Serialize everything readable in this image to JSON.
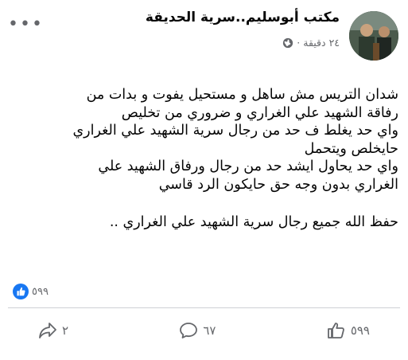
{
  "post": {
    "page_name": "مكتب أبوسليم..سرية الحديقة",
    "time": "٢٤ دقيقة",
    "visibility_icon": "globe-icon",
    "lines": [
      "شدان التريس مش ساهل و مستحيل يفوت و بدات من",
      "رفاقة الشهيد علي الغراري و ضروري من تخليص",
      "واي حد يغلط ف حد من رجال سرية الشهيد علي الغراري",
      "حايخلص ويتحمل",
      "واي حد يحاول ايشد حد من رجال ورفاق الشهيد علي",
      "الغراري بدون وجه حق حايكون الرد قاسي"
    ],
    "closing": "حفظ الله جميع رجال سرية الشهيد علي الغراري .."
  },
  "reactions": {
    "icon": "like-icon",
    "count": "٥٩٩"
  },
  "actions": {
    "like": {
      "icon": "thumbs-up-icon",
      "count": "٥٩٩"
    },
    "comment": {
      "icon": "comment-icon",
      "count": "٦٧"
    },
    "share": {
      "icon": "share-icon",
      "count": "٢"
    }
  },
  "colors": {
    "accent": "#1877f2",
    "muted": "#65676b"
  }
}
